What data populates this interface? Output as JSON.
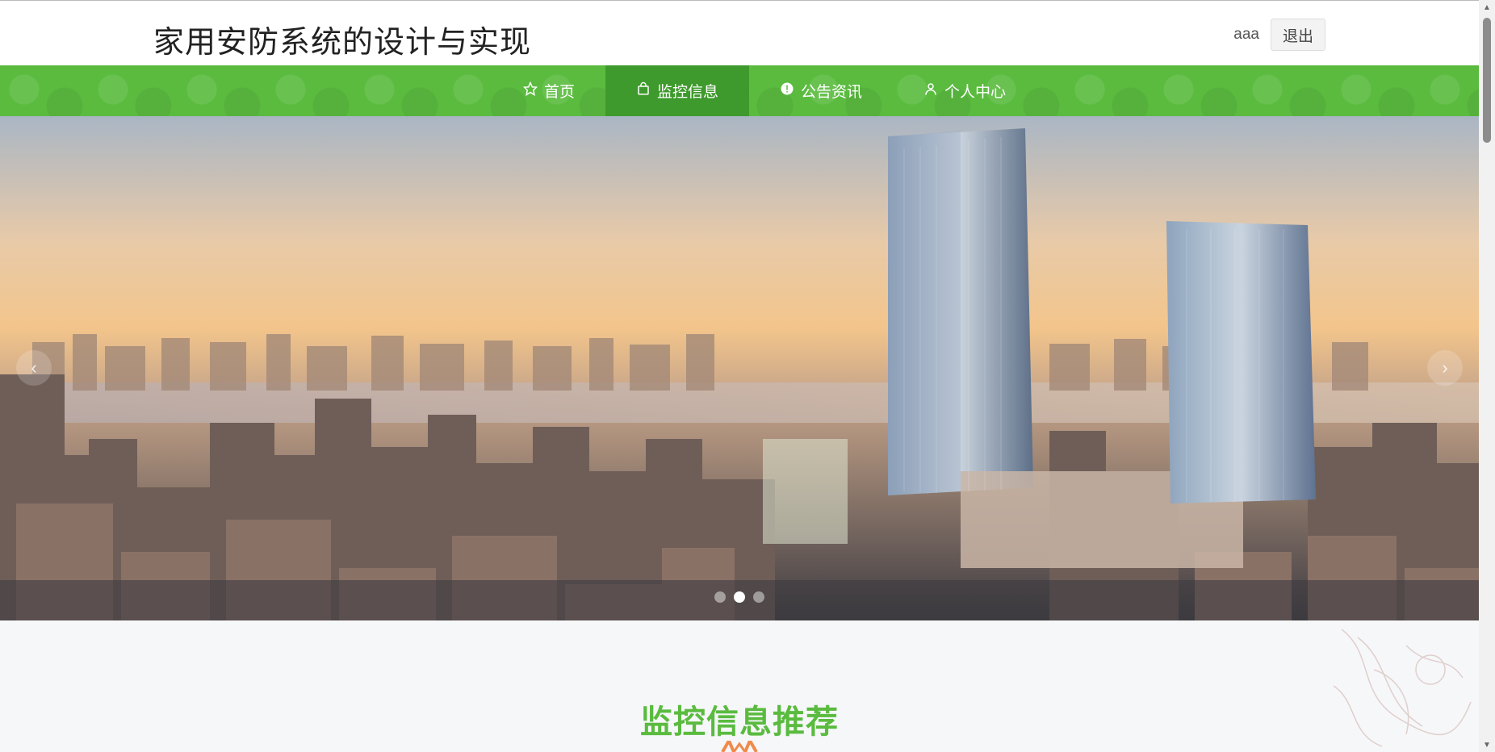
{
  "header": {
    "site_title": "家用安防系统的设计与实现",
    "username": "aaa",
    "logout_label": "退出"
  },
  "nav": {
    "items": [
      {
        "label": "首页",
        "icon": "star-icon",
        "active": false
      },
      {
        "label": "监控信息",
        "icon": "bag-icon",
        "active": true
      },
      {
        "label": "公告资讯",
        "icon": "alert-circle-icon",
        "active": false
      },
      {
        "label": "个人中心",
        "icon": "user-icon",
        "active": false
      }
    ]
  },
  "carousel": {
    "prev_glyph": "‹",
    "next_glyph": "›",
    "slide_count": 3,
    "active_slide": 2
  },
  "section": {
    "title": "监控信息推荐"
  },
  "colors": {
    "brand_green": "#5abb3f",
    "active_nav": "#3e9a2c"
  }
}
